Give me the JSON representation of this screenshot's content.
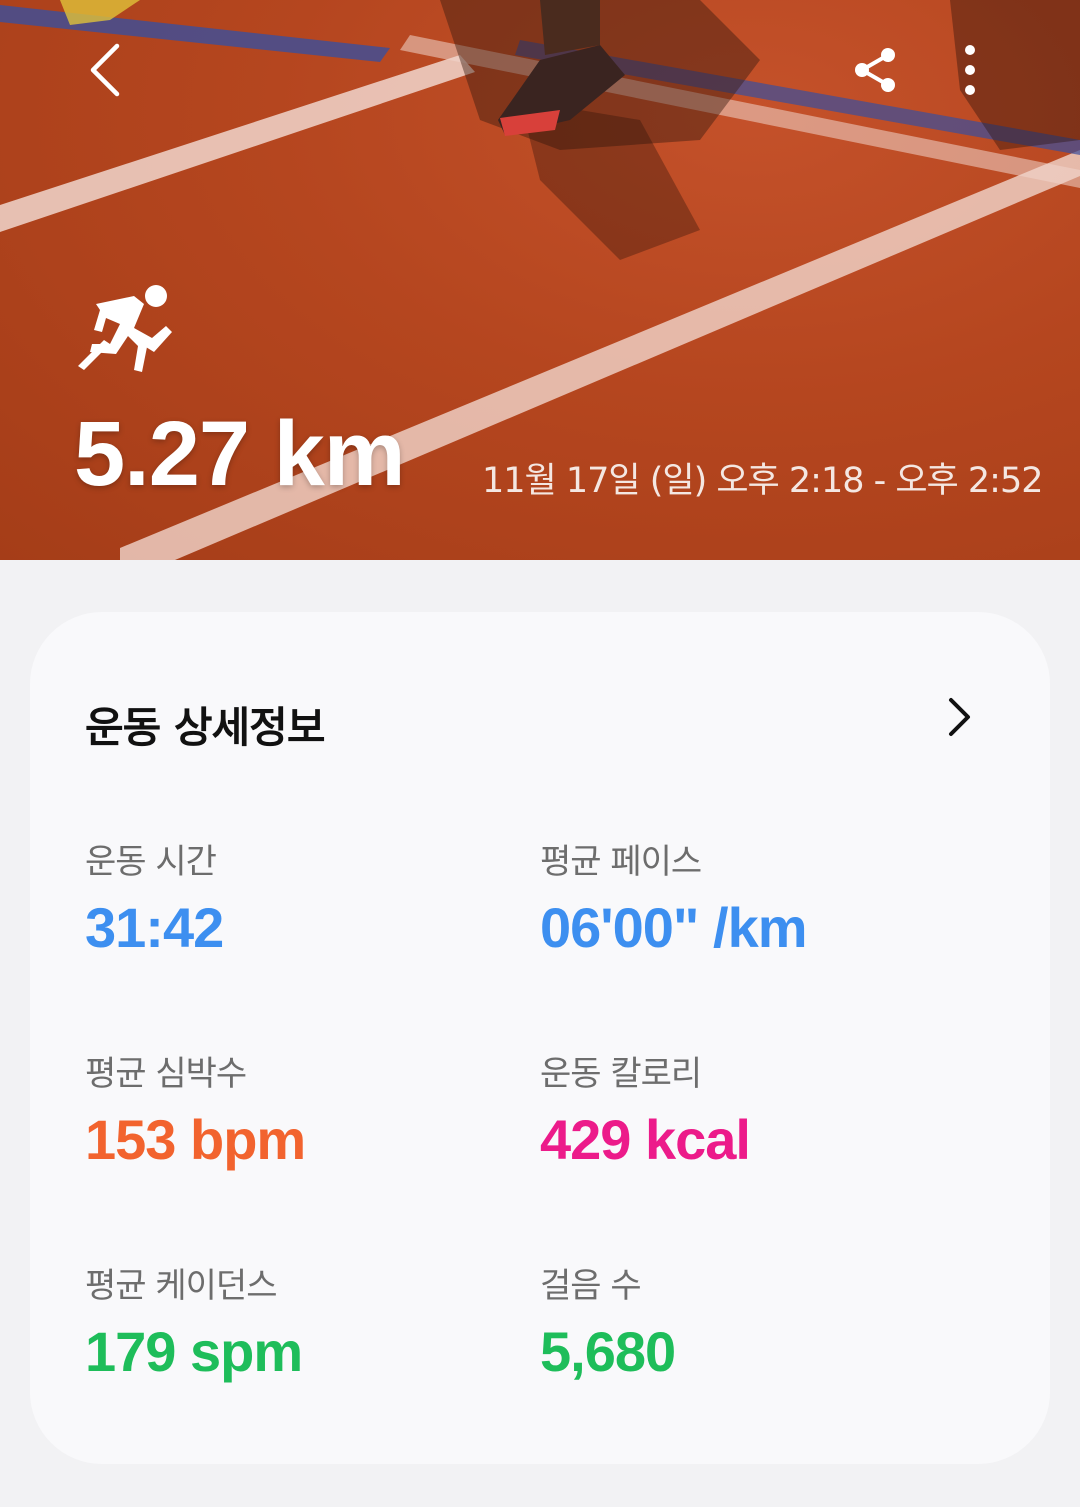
{
  "hero": {
    "distance": "5.27 km",
    "date_range": "11월 17일 (일) 오후 2:18 - 오후 2:52"
  },
  "details": {
    "title": "운동 상세정보",
    "metrics": [
      {
        "label": "운동 시간",
        "value": "31:42",
        "color": "#3d8ff0"
      },
      {
        "label": "평균 페이스",
        "value": "06'00\" /km",
        "color": "#3d8ff0"
      },
      {
        "label": "평균 심박수",
        "value": "153 bpm",
        "color": "#f2632e"
      },
      {
        "label": "운동 칼로리",
        "value": "429 kcal",
        "color": "#ec1b8a"
      },
      {
        "label": "평균 케이던스",
        "value": "179 spm",
        "color": "#1ebd5a"
      },
      {
        "label": "걸음 수",
        "value": "5,680",
        "color": "#1ebd5a"
      }
    ]
  },
  "icons": {
    "back": "chevron-left-icon",
    "share": "share-icon",
    "more": "more-vertical-icon",
    "activity": "running-icon",
    "details": "chevron-right-icon"
  }
}
